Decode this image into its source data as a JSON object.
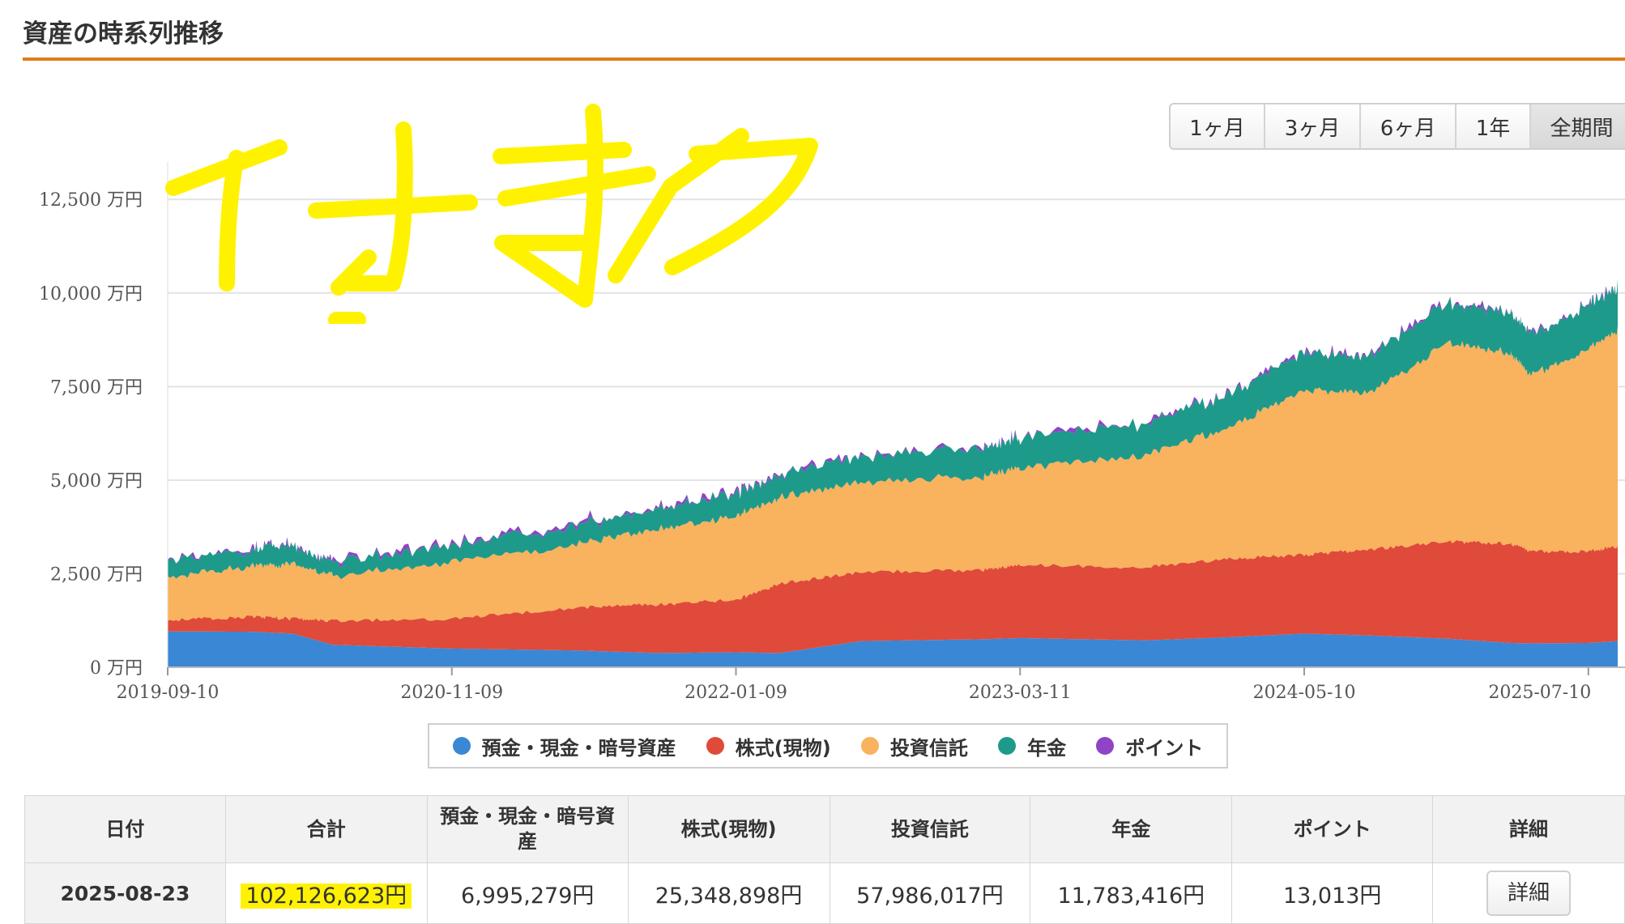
{
  "page_title": "資産の時系列推移",
  "period_buttons": [
    {
      "label": "1ヶ月",
      "active": false
    },
    {
      "label": "3ヶ月",
      "active": false
    },
    {
      "label": "6ヶ月",
      "active": false
    },
    {
      "label": "1年",
      "active": false
    },
    {
      "label": "全期間",
      "active": true
    }
  ],
  "colors": {
    "deposit": "#3a87d6",
    "stock": "#e04a3a",
    "fund": "#f9b25e",
    "pension": "#1e9a8a",
    "point": "#8e44c4",
    "accent": "#e07b1a",
    "highlight": "#fff200"
  },
  "handwritten_note": "イチオク",
  "chart_data": {
    "type": "area",
    "stacked": true,
    "y_unit": "万円",
    "ylim": [
      0,
      13500
    ],
    "yticks": [
      0,
      2500,
      5000,
      7500,
      10000,
      12500
    ],
    "ytick_labels": [
      "0 万円",
      "2,500 万円",
      "5,000 万円",
      "7,500 万円",
      "10,000 万円",
      "12,500 万円"
    ],
    "xtick_labels": [
      "2019-09-10",
      "2020-11-09",
      "2022-01-09",
      "2023-03-11",
      "2024-05-10",
      "2025-07-10"
    ],
    "x": [
      "2019-09-10",
      "2020-01",
      "2020-03",
      "2020-05",
      "2020-11-09",
      "2021-05",
      "2021-09",
      "2022-01-09",
      "2022-03",
      "2022-07",
      "2023-01",
      "2023-03-11",
      "2023-09",
      "2024-01",
      "2024-05-10",
      "2024-08",
      "2024-12",
      "2025-03",
      "2025-04",
      "2025-07-10",
      "2025-08-23"
    ],
    "series": [
      {
        "name": "預金・現金・暗号資産",
        "color": "#3a87d6",
        "values": [
          960,
          950,
          900,
          600,
          500,
          450,
          380,
          400,
          380,
          700,
          750,
          780,
          720,
          800,
          900,
          850,
          760,
          650,
          640,
          650,
          700
        ]
      },
      {
        "name": "株式(現物)",
        "color": "#e04a3a",
        "values": [
          300,
          400,
          400,
          650,
          800,
          1150,
          1300,
          1400,
          1850,
          1850,
          1850,
          1950,
          1950,
          2100,
          2100,
          2300,
          2600,
          2650,
          2450,
          2450,
          2535
        ]
      },
      {
        "name": "投資信託",
        "color": "#f9b25e",
        "values": [
          1150,
          1350,
          1450,
          1200,
          1500,
          1700,
          2000,
          2250,
          2300,
          2400,
          2500,
          2600,
          3000,
          3500,
          4400,
          4200,
          5300,
          5100,
          4700,
          5400,
          5799
        ]
      },
      {
        "name": "年金",
        "color": "#1e9a8a",
        "values": [
          450,
          450,
          480,
          380,
          450,
          500,
          550,
          600,
          600,
          700,
          750,
          800,
          850,
          900,
          1000,
          1000,
          1050,
          1100,
          1100,
          1150,
          1178
        ]
      },
      {
        "name": "ポイント",
        "color": "#8e44c4",
        "values": [
          1,
          1,
          1,
          1,
          1,
          1,
          1,
          1,
          1,
          1,
          1,
          1,
          1,
          1,
          1,
          1,
          1,
          1,
          1,
          1,
          1
        ]
      }
    ],
    "legend": [
      "預金・現金・暗号資産",
      "株式(現物)",
      "投資信託",
      "年金",
      "ポイント"
    ],
    "legend_position": "bottom",
    "grid": true
  },
  "table": {
    "headers": [
      "日付",
      "合計",
      "預金・現金・暗号資産",
      "株式(現物)",
      "投資信託",
      "年金",
      "ポイント",
      "詳細"
    ],
    "row": {
      "date": "2025-08-23",
      "total": "102,126,623円",
      "deposit": "6,995,279円",
      "stock": "25,348,898円",
      "fund": "57,986,017円",
      "pension": "11,783,416円",
      "point": "13,013円",
      "detail_button": "詳細"
    }
  }
}
